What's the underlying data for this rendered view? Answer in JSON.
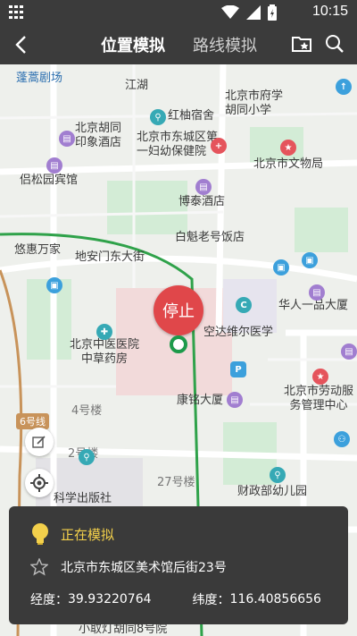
{
  "status_bar": {
    "time": "10:15"
  },
  "title_bar": {
    "tab_active": "位置模拟",
    "tab_inactive": "路线模拟"
  },
  "map": {
    "stop_label": "停止",
    "metro_line_label": "6号线",
    "labels": {
      "penglai": "蓬蒿剧场",
      "jianghu": "江湖",
      "xuexiao": "北京市府学胡同小学",
      "hongyou": "红柚宿舍",
      "yinxiang": "北京胡同印象酒店",
      "fuyou": "北京市东城区第一妇幼保健院",
      "wenwu": "北京市文物局",
      "lvsong": "侣松园宾馆",
      "botai": "博泰酒店",
      "baikui": "白魁老号饭店",
      "youhui": "悠惠万家",
      "dianmen": "地安门东大街",
      "huaren": "华人一品大厦",
      "kongda": "空达维尔医学",
      "zhongyi": "北京中医医院中草药房",
      "kangming": "康铭大厦",
      "laodong": "北京市劳动服务管理中心",
      "haolou4": "4号楼",
      "haolou2": "2号楼",
      "haolou27": "27号楼",
      "kexue": "科学出版社",
      "caizheng": "财政部幼儿园",
      "xiaoqu": "小取灯胡同8号院"
    }
  },
  "panel": {
    "status": "正在模拟",
    "address": "北京市东城区美术馆后街23号",
    "lat_label": "经度：",
    "lat_value": "39.93220764",
    "lng_label": "纬度：",
    "lng_value": "116.40856656"
  },
  "colors": {
    "accent_red": "#e0474a",
    "route_green": "#1d9a4a",
    "status_yellow": "#f3d04b",
    "bar_dark": "#3b3b3b"
  },
  "icons": [
    "grid-icon",
    "wifi-icon",
    "signal-icon",
    "battery-icon",
    "back-arrow-icon",
    "favorite-folder-icon",
    "search-icon",
    "edit-icon",
    "locate-icon",
    "lightbulb-icon",
    "star-icon"
  ]
}
